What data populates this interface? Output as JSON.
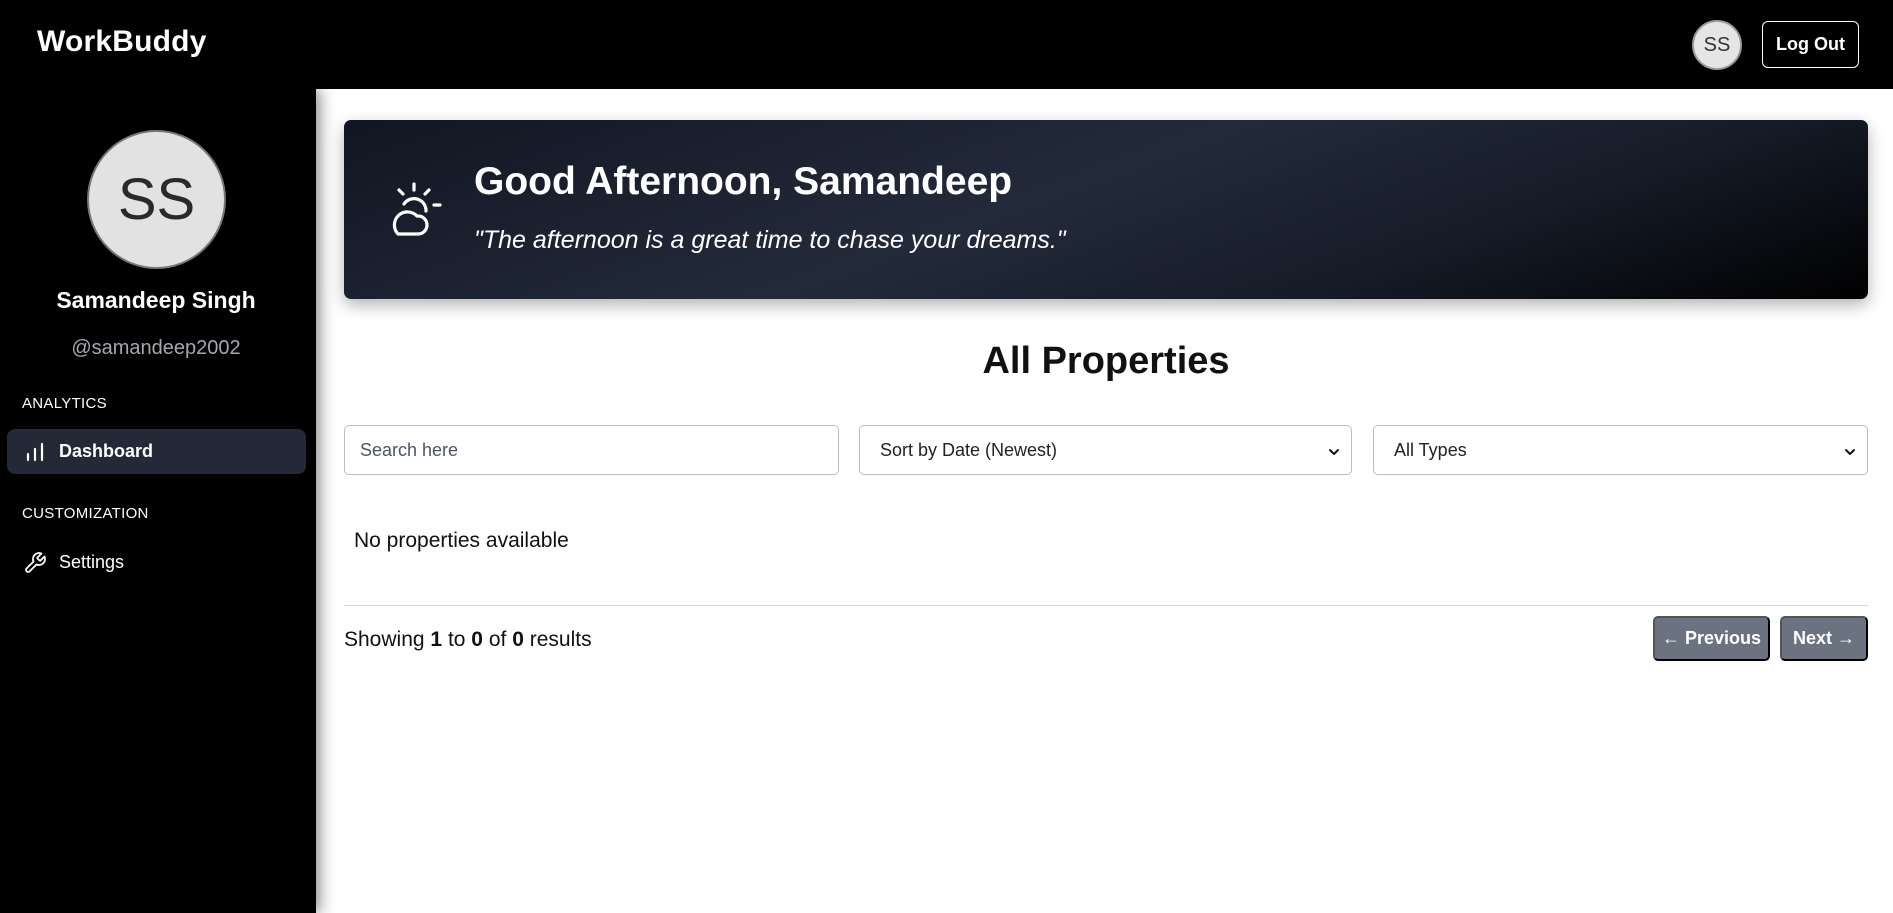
{
  "header": {
    "brand": "WorkBuddy",
    "avatar_initials": "SS",
    "logout_label": "Log Out"
  },
  "sidebar": {
    "avatar_initials": "SS",
    "user_name": "Samandeep Singh",
    "user_handle": "@samandeep2002",
    "sections": [
      {
        "label": "ANALYTICS",
        "items": [
          {
            "label": "Dashboard",
            "icon": "bar-chart-icon",
            "active": true
          }
        ]
      },
      {
        "label": "CUSTOMIZATION",
        "items": [
          {
            "label": "Settings",
            "icon": "wrench-icon",
            "active": false
          }
        ]
      }
    ]
  },
  "banner": {
    "icon": "partly-cloudy-icon",
    "greeting": "Good Afternoon, Samandeep",
    "quote": "\"The afternoon is a great time to chase your dreams.\""
  },
  "main": {
    "title": "All Properties",
    "search": {
      "placeholder": "Search here",
      "value": ""
    },
    "sort_select": {
      "selected": "Sort by Date (Newest)"
    },
    "type_select": {
      "selected": "All Types"
    },
    "empty_message": "No properties available",
    "pagination": {
      "showing_prefix": "Showing",
      "from": "1",
      "to_word": "to",
      "to": "0",
      "of_word": "of",
      "total": "0",
      "results_word": "results",
      "previous_label": "← Previous",
      "next_label": "Next →"
    }
  },
  "colors": {
    "sidebar_bg": "#000000",
    "active_nav_bg": "#232936",
    "pager_button_bg": "#6b7280"
  }
}
